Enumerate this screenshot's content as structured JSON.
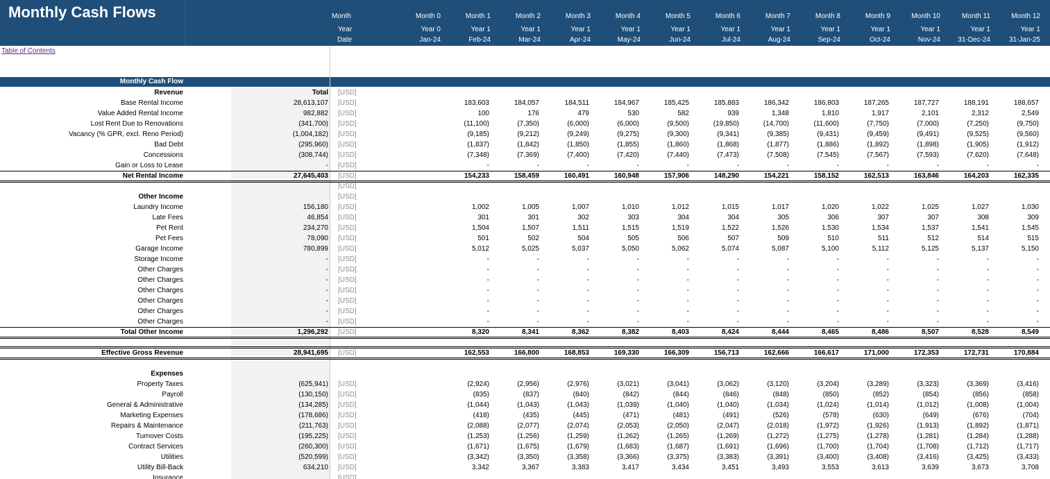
{
  "sheet": {
    "title": "Monthly Cash Flows",
    "toc_link": "Table of Contents",
    "header_labels": [
      "Month",
      "Year",
      "Date"
    ],
    "months": [
      "Month 0",
      "Month 1",
      "Month 2",
      "Month 3",
      "Month 4",
      "Month 5",
      "Month 6",
      "Month 7",
      "Month 8",
      "Month 9",
      "Month 10",
      "Month 11",
      "Month 12"
    ],
    "years": [
      "Year 0",
      "Year 1",
      "Year 1",
      "Year 1",
      "Year 1",
      "Year 1",
      "Year 1",
      "Year 1",
      "Year 1",
      "Year 1",
      "Year 1",
      "Year 1",
      "Year 1"
    ],
    "dates": [
      "Jan-24",
      "Feb-24",
      "Mar-24",
      "Apr-24",
      "May-24",
      "Jun-24",
      "Jul-24",
      "Aug-24",
      "Sep-24",
      "Oct-24",
      "Nov-24",
      "31-Dec-24",
      "31-Jan-25"
    ],
    "section_title": "Monthly Cash Flow",
    "unit_label": "[USD]",
    "colors": {
      "header_bg": "#1f4e79",
      "header_text": "#ffffff",
      "total_col_bg": "#f2f2f2",
      "unit_text": "#8c8c8c",
      "link": "#5b2c83"
    }
  },
  "rows": [
    {
      "label": "Revenue",
      "bold": true,
      "total": "Total",
      "unit": "[USD]",
      "values": []
    },
    {
      "label": "Base Rental Income",
      "total": "28,613,107",
      "unit": "[USD]",
      "values": [
        "",
        "183,603",
        "184,057",
        "184,511",
        "184,967",
        "185,425",
        "185,883",
        "186,342",
        "186,803",
        "187,265",
        "187,727",
        "188,191",
        "188,657"
      ]
    },
    {
      "label": "Value Added Rental Income",
      "total": "982,882",
      "unit": "[USD]",
      "values": [
        "",
        "100",
        "176",
        "479",
        "530",
        "582",
        "939",
        "1,348",
        "1,810",
        "1,917",
        "2,101",
        "2,312",
        "2,549"
      ]
    },
    {
      "label": "Lost Rent Due to Renovations",
      "total": "(341,700)",
      "unit": "[USD]",
      "values": [
        "",
        "(11,100)",
        "(7,350)",
        "(6,000)",
        "(6,000)",
        "(9,500)",
        "(19,850)",
        "(14,700)",
        "(11,600)",
        "(7,750)",
        "(7,000)",
        "(7,250)",
        "(9,750)"
      ]
    },
    {
      "label": "Vacancy (% GPR, excl. Reno Period)",
      "total": "(1,004,182)",
      "unit": "[USD]",
      "values": [
        "",
        "(9,185)",
        "(9,212)",
        "(9,249)",
        "(9,275)",
        "(9,300)",
        "(9,341)",
        "(9,385)",
        "(9,431)",
        "(9,459)",
        "(9,491)",
        "(9,525)",
        "(9,560)"
      ]
    },
    {
      "label": "Bad Debt",
      "total": "(295,960)",
      "unit": "[USD]",
      "values": [
        "",
        "(1,837)",
        "(1,842)",
        "(1,850)",
        "(1,855)",
        "(1,860)",
        "(1,868)",
        "(1,877)",
        "(1,886)",
        "(1,892)",
        "(1,898)",
        "(1,905)",
        "(1,912)"
      ]
    },
    {
      "label": "Concessions",
      "total": "(308,744)",
      "unit": "[USD]",
      "values": [
        "",
        "(7,348)",
        "(7,369)",
        "(7,400)",
        "(7,420)",
        "(7,440)",
        "(7,473)",
        "(7,508)",
        "(7,545)",
        "(7,567)",
        "(7,593)",
        "(7,620)",
        "(7,648)"
      ]
    },
    {
      "label": "Gain or Loss to Lease",
      "total": "-",
      "unit": "[USD]",
      "values": [
        "",
        "-",
        "-",
        "-",
        "-",
        "-",
        "-",
        "-",
        "-",
        "-",
        "-",
        "-",
        "-"
      ]
    },
    {
      "label": "Net Rental Income",
      "bold": true,
      "rule": "double",
      "total": "27,645,403",
      "unit": "[USD]",
      "values": [
        "",
        "154,233",
        "158,459",
        "160,491",
        "160,948",
        "157,906",
        "148,290",
        "154,221",
        "158,152",
        "162,513",
        "163,846",
        "164,203",
        "162,335"
      ]
    },
    {
      "label": "",
      "total": "",
      "unit": "[USD]",
      "values": []
    },
    {
      "label": "Other Income",
      "bold": true,
      "total": "",
      "unit": "[USD]",
      "values": []
    },
    {
      "label": "Laundry Income",
      "total": "156,180",
      "unit": "[USD]",
      "values": [
        "",
        "1,002",
        "1,005",
        "1,007",
        "1,010",
        "1,012",
        "1,015",
        "1,017",
        "1,020",
        "1,022",
        "1,025",
        "1,027",
        "1,030"
      ]
    },
    {
      "label": "Late Fees",
      "total": "46,854",
      "unit": "[USD]",
      "values": [
        "",
        "301",
        "301",
        "302",
        "303",
        "304",
        "304",
        "305",
        "306",
        "307",
        "307",
        "308",
        "309"
      ]
    },
    {
      "label": "Pet Rent",
      "total": "234,270",
      "unit": "[USD]",
      "values": [
        "",
        "1,504",
        "1,507",
        "1,511",
        "1,515",
        "1,519",
        "1,522",
        "1,526",
        "1,530",
        "1,534",
        "1,537",
        "1,541",
        "1,545"
      ]
    },
    {
      "label": "Pet Fees",
      "total": "78,090",
      "unit": "[USD]",
      "values": [
        "",
        "501",
        "502",
        "504",
        "505",
        "506",
        "507",
        "509",
        "510",
        "511",
        "512",
        "514",
        "515"
      ]
    },
    {
      "label": "Garage Income",
      "total": "780,899",
      "unit": "[USD]",
      "values": [
        "",
        "5,012",
        "5,025",
        "5,037",
        "5,050",
        "5,062",
        "5,074",
        "5,087",
        "5,100",
        "5,112",
        "5,125",
        "5,137",
        "5,150"
      ]
    },
    {
      "label": "Storage Income",
      "total": "-",
      "unit": "[USD]",
      "values": [
        "",
        "-",
        "-",
        "-",
        "-",
        "-",
        "-",
        "-",
        "-",
        "-",
        "-",
        "-",
        "-"
      ]
    },
    {
      "label": "Other Charges",
      "total": "-",
      "unit": "[USD]",
      "values": [
        "",
        "-",
        "-",
        "-",
        "-",
        "-",
        "-",
        "-",
        "-",
        "-",
        "-",
        "-",
        "-"
      ]
    },
    {
      "label": "Other Charges",
      "total": "-",
      "unit": "[USD]",
      "values": [
        "",
        "-",
        "-",
        "-",
        "-",
        "-",
        "-",
        "-",
        "-",
        "-",
        "-",
        "-",
        "-"
      ]
    },
    {
      "label": "Other Charges",
      "total": "-",
      "unit": "[USD]",
      "values": [
        "",
        "-",
        "-",
        "-",
        "-",
        "-",
        "-",
        "-",
        "-",
        "-",
        "-",
        "-",
        "-"
      ]
    },
    {
      "label": "Other Charges",
      "total": "-",
      "unit": "[USD]",
      "values": [
        "",
        "-",
        "-",
        "-",
        "-",
        "-",
        "-",
        "-",
        "-",
        "-",
        "-",
        "-",
        "-"
      ]
    },
    {
      "label": "Other Charges",
      "total": "-",
      "unit": "[USD]",
      "values": [
        "",
        "-",
        "-",
        "-",
        "-",
        "-",
        "-",
        "-",
        "-",
        "-",
        "-",
        "-",
        "-"
      ]
    },
    {
      "label": "Other Charges",
      "total": "-",
      "unit": "[USD]",
      "values": [
        "",
        "-",
        "-",
        "-",
        "-",
        "-",
        "-",
        "-",
        "-",
        "-",
        "-",
        "-",
        "-"
      ]
    },
    {
      "label": "Total Other Income",
      "bold": true,
      "rule": "double",
      "total": "1,296,292",
      "unit": "[USD]",
      "values": [
        "",
        "8,320",
        "8,341",
        "8,362",
        "8,382",
        "8,403",
        "8,424",
        "8,444",
        "8,465",
        "8,486",
        "8,507",
        "8,528",
        "8,549"
      ]
    },
    {
      "label": "",
      "total": "",
      "unit": "",
      "values": []
    },
    {
      "label": "Effective Gross Revenue",
      "bold": true,
      "rule": "double-both",
      "total": "28,941,695",
      "unit": "[USD]",
      "values": [
        "",
        "162,553",
        "166,800",
        "168,853",
        "169,330",
        "166,309",
        "156,713",
        "162,666",
        "166,617",
        "171,000",
        "172,353",
        "172,731",
        "170,884"
      ]
    },
    {
      "label": "",
      "total": "",
      "unit": "",
      "values": []
    },
    {
      "label": "Expenses",
      "bold": true,
      "total": "",
      "unit": "",
      "values": []
    },
    {
      "label": "Property Taxes",
      "total": "(625,941)",
      "unit": "[USD]",
      "values": [
        "",
        "(2,924)",
        "(2,956)",
        "(2,976)",
        "(3,021)",
        "(3,041)",
        "(3,062)",
        "(3,120)",
        "(3,204)",
        "(3,289)",
        "(3,323)",
        "(3,369)",
        "(3,416)"
      ]
    },
    {
      "label": "Payroll",
      "total": "(130,150)",
      "unit": "[USD]",
      "values": [
        "",
        "(835)",
        "(837)",
        "(840)",
        "(842)",
        "(844)",
        "(846)",
        "(848)",
        "(850)",
        "(852)",
        "(854)",
        "(856)",
        "(858)"
      ]
    },
    {
      "label": "General & Administrative",
      "total": "(134,285)",
      "unit": "[USD]",
      "values": [
        "",
        "(1,044)",
        "(1,043)",
        "(1,043)",
        "(1,039)",
        "(1,040)",
        "(1,040)",
        "(1,034)",
        "(1,024)",
        "(1,014)",
        "(1,012)",
        "(1,008)",
        "(1,004)"
      ]
    },
    {
      "label": "Marketing Expenses",
      "total": "(178,686)",
      "unit": "[USD]",
      "values": [
        "",
        "(418)",
        "(435)",
        "(445)",
        "(471)",
        "(481)",
        "(491)",
        "(526)",
        "(578)",
        "(630)",
        "(649)",
        "(676)",
        "(704)"
      ]
    },
    {
      "label": "Repairs & Maintenance",
      "total": "(211,763)",
      "unit": "[USD]",
      "values": [
        "",
        "(2,088)",
        "(2,077)",
        "(2,074)",
        "(2,053)",
        "(2,050)",
        "(2,047)",
        "(2,018)",
        "(1,972)",
        "(1,926)",
        "(1,913)",
        "(1,892)",
        "(1,871)"
      ]
    },
    {
      "label": "Turnover Costs",
      "total": "(195,225)",
      "unit": "[USD]",
      "values": [
        "",
        "(1,253)",
        "(1,256)",
        "(1,259)",
        "(1,262)",
        "(1,265)",
        "(1,269)",
        "(1,272)",
        "(1,275)",
        "(1,278)",
        "(1,281)",
        "(1,284)",
        "(1,288)"
      ]
    },
    {
      "label": "Contract Services",
      "total": "(260,300)",
      "unit": "[USD]",
      "values": [
        "",
        "(1,671)",
        "(1,675)",
        "(1,679)",
        "(1,683)",
        "(1,687)",
        "(1,691)",
        "(1,696)",
        "(1,700)",
        "(1,704)",
        "(1,708)",
        "(1,712)",
        "(1,717)"
      ]
    },
    {
      "label": "Utilities",
      "total": "(520,599)",
      "unit": "[USD]",
      "values": [
        "",
        "(3,342)",
        "(3,350)",
        "(3,358)",
        "(3,366)",
        "(3,375)",
        "(3,383)",
        "(3,391)",
        "(3,400)",
        "(3,408)",
        "(3,416)",
        "(3,425)",
        "(3,433)"
      ]
    },
    {
      "label": "Utility Bill-Back",
      "total": "634,210",
      "unit": "[USD]",
      "values": [
        "",
        "3,342",
        "3,367",
        "3,383",
        "3,417",
        "3,434",
        "3,451",
        "3,493",
        "3,553",
        "3,613",
        "3,639",
        "3,673",
        "3,708"
      ]
    },
    {
      "label": "Insurance",
      "total": "",
      "unit": "[USD]",
      "values": []
    }
  ]
}
